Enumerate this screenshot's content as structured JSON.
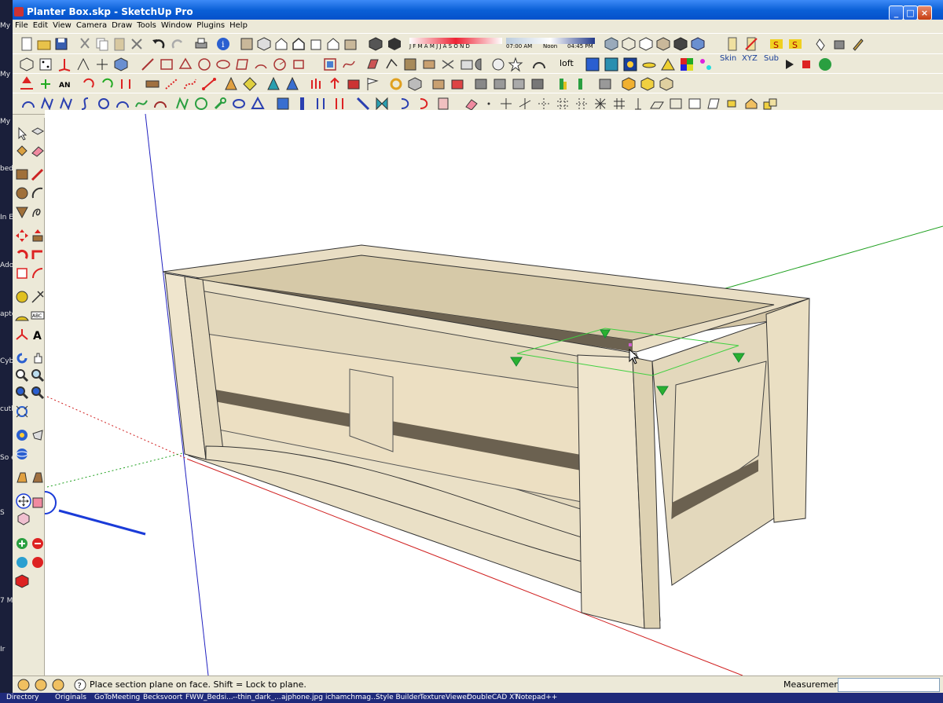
{
  "window": {
    "title": "Planter Box.skp - SketchUp Pro"
  },
  "menu": [
    "File",
    "Edit",
    "View",
    "Camera",
    "Draw",
    "Tools",
    "Window",
    "Plugins",
    "Help"
  ],
  "shadow": {
    "months": "J F M A M J J A S O N D",
    "time_start": "07:00 AM",
    "time_mid": "Noon",
    "time_end": "04:45 PM"
  },
  "toolbar_text": {
    "loft": "loft",
    "skin": "Skin",
    "xyz": "XYZ",
    "sub": "Sub"
  },
  "desktop_labels": [
    "My D",
    "My",
    "My",
    "bed",
    "In\nE",
    "Ado",
    "apte",
    "Cybe",
    "cutl",
    "So\neD",
    "S",
    "7\nM",
    "Ir"
  ],
  "status": {
    "message": "Place section plane on face.  Shift = Lock to plane.",
    "measurements_label": "Measurements",
    "measurements_value": ""
  },
  "taskbar": [
    "Directory",
    "Originals",
    "GoToMeeting",
    "Becksvoort",
    "FWW_Bedsi...",
    "--thin_dark_...",
    "ajphone.jpg",
    "ichamchmag...",
    "Style Builder",
    "TextureViewer",
    "DoubleCAD XT",
    "Notepad++"
  ],
  "accent": {
    "title": "#0a5fd6",
    "red_axis": "#d02020",
    "green_axis": "#20a020",
    "blue_axis": "#2020c0",
    "wood": "#e8dcc0",
    "arrow": "#1a3bd8"
  }
}
